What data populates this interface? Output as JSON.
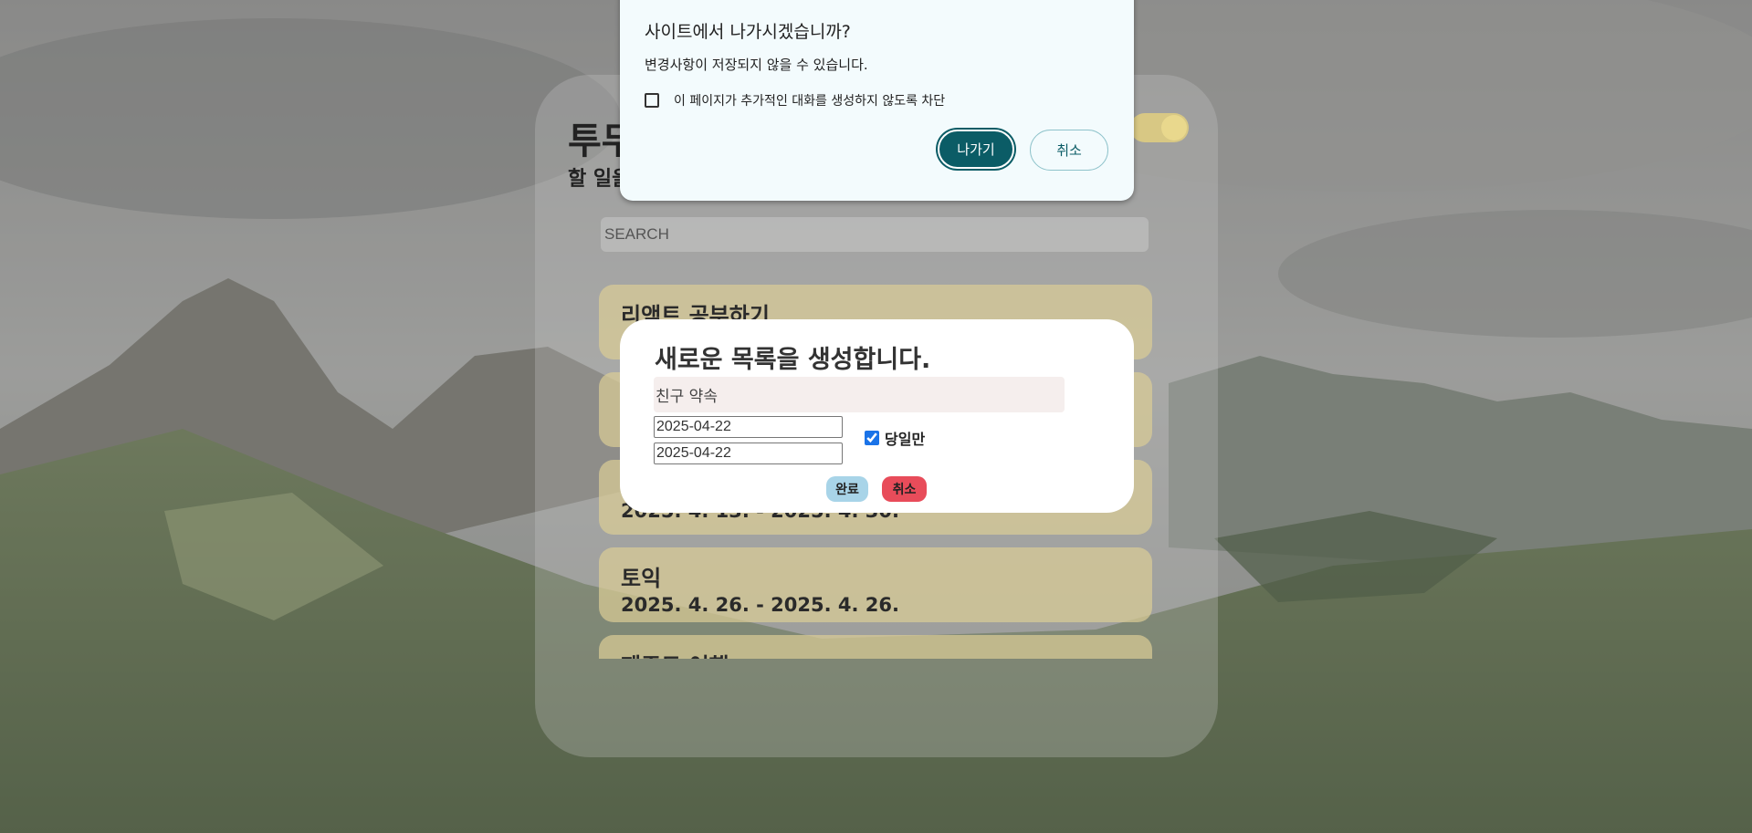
{
  "colors": {
    "dialog_primary": "#0b5c66",
    "todo_card": "#dccd96",
    "done_button": "#a8d4e8",
    "cancel_button": "#e84c5a",
    "toggle": "#d8c884"
  },
  "app": {
    "title": "투두",
    "subtitle": "할 일을",
    "search_placeholder": "SEARCH",
    "todos": [
      {
        "title": "리액트 공부하기",
        "date": ""
      },
      {
        "title": "",
        "date": ""
      },
      {
        "title": "",
        "date": "2025. 4. 13. - 2025. 4. 30."
      },
      {
        "title": "토익",
        "date": "2025. 4. 26. - 2025. 4. 26."
      },
      {
        "title": "제주도 여행",
        "date": ""
      }
    ]
  },
  "new_item_modal": {
    "title": "새로운 목록을 생성합니다.",
    "name_value": "친구 약속",
    "start_date": "2025-04-22",
    "end_date": "2025-04-22",
    "same_day_label": "당일만",
    "same_day_checked": true,
    "done_label": "완료",
    "cancel_label": "취소"
  },
  "leave_dialog": {
    "title": "사이트에서 나가시겠습니까?",
    "message": "변경사항이 저장되지 않을 수 있습니다.",
    "block_label": "이 페이지가 추가적인 대화를 생성하지 않도록 차단",
    "leave_label": "나가기",
    "cancel_label": "취소"
  }
}
